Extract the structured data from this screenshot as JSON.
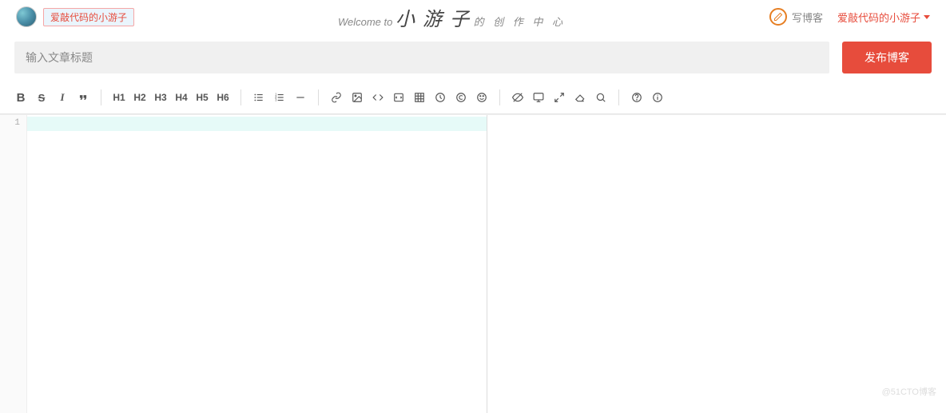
{
  "header": {
    "user_tag": "爱敲代码的小游子",
    "welcome_prefix": "Welcome to ",
    "welcome_main": "小 游 子",
    "welcome_suffix": " 的 创 作 中 心",
    "write_blog": "写博客",
    "user_dropdown": "爱敲代码的小游子"
  },
  "title_bar": {
    "placeholder": "输入文章标题",
    "value": "",
    "publish_label": "发布博客"
  },
  "toolbar": {
    "h1": "H1",
    "h2": "H2",
    "h3": "H3",
    "h4": "H4",
    "h5": "H5",
    "h6": "H6"
  },
  "editor": {
    "line_number": "1"
  },
  "watermark": "@51CTO博客"
}
